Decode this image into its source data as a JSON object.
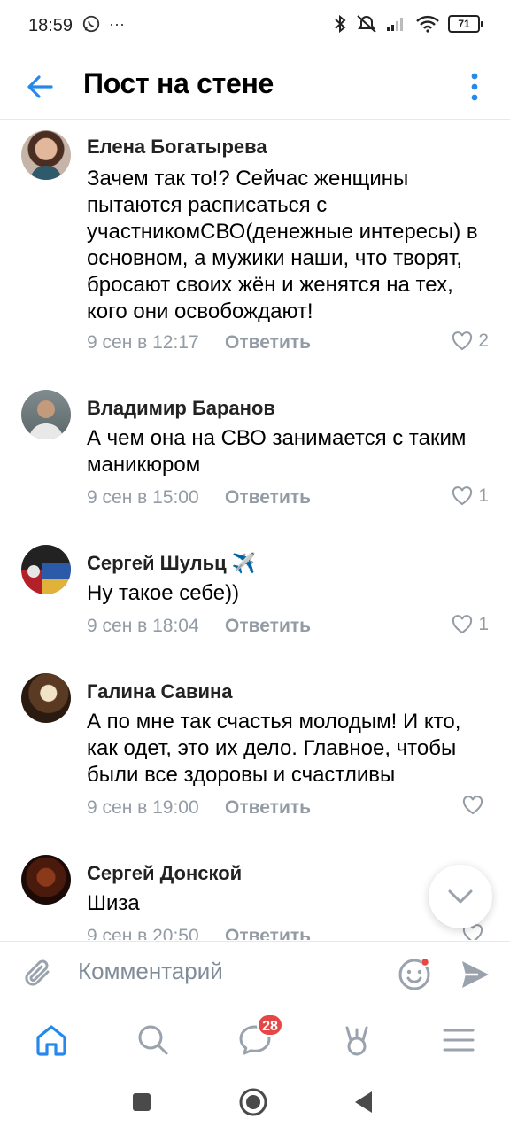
{
  "status_bar": {
    "time": "18:59",
    "left_icons": [
      "whatsapp-icon",
      "more-notifications-icon"
    ],
    "right_icons": [
      "bluetooth-icon",
      "mute-icon",
      "signal-icon",
      "wifi-icon"
    ],
    "battery": "71"
  },
  "header": {
    "title": "Пост на стене",
    "back_icon": "arrow-left-icon",
    "menu_icon": "vertical-dots-icon"
  },
  "comments": [
    {
      "author": "Елена Богатырева",
      "text": "Зачем так то!? Сейчас женщины пытаются расписаться с участникомСВО(денежные интересы) в основном, а мужики наши, что творят, бросают своих жён и женятся на  тех, кого они освобождают!",
      "date": "9 сен в 12:17",
      "reply": "Ответить",
      "likes": "2"
    },
    {
      "author": "Владимир Баранов",
      "text": "А чем она на СВО занимается с таким маникюром",
      "date": "9 сен в 15:00",
      "reply": "Ответить",
      "likes": "1"
    },
    {
      "author": "Сергей Шульц",
      "author_emoji": "✈️",
      "text": "Ну такое себе))",
      "date": "9 сен в 18:04",
      "reply": "Ответить",
      "likes": "1"
    },
    {
      "author": "Галина Савина",
      "text": "А по мне так счастья молодым! И кто, как одет, это их дело. Главное, чтобы были все здоровы и счастливы",
      "date": "9 сен в 19:00",
      "reply": "Ответить",
      "likes": ""
    },
    {
      "author": "Сергей Донской",
      "text": "Шиза",
      "date": "9 сен в 20:50",
      "reply": "Ответить",
      "likes": ""
    }
  ],
  "input_bar": {
    "placeholder": "Комментарий"
  },
  "bottom_nav": {
    "items": [
      "home-icon",
      "search-icon",
      "messages-icon",
      "services-icon",
      "menu-icon"
    ],
    "messages_badge": "28"
  },
  "colors": {
    "accent": "#2688eb",
    "secondary_text": "#939ba4",
    "badge": "#e64646",
    "nav_icon": "#99a2ad"
  }
}
